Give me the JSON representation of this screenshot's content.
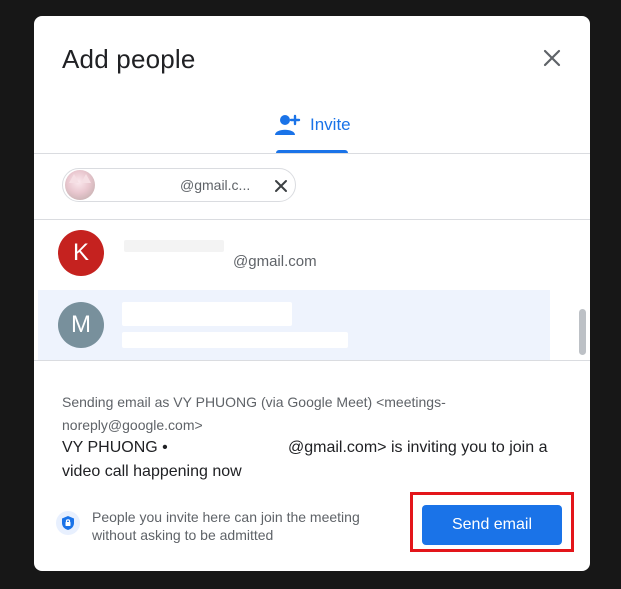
{
  "dialog": {
    "title": "Add people",
    "tab_invite": "Invite",
    "chip": {
      "email": "@gmail.c..."
    },
    "suggestions": [
      {
        "initial": "K",
        "email": "@gmail.com",
        "color": "#c5221f"
      },
      {
        "initial": "M",
        "email": "",
        "color": "#78909c"
      }
    ],
    "sending_note": "Sending email as VY PHUONG (via Google Meet) <meetings-noreply@google.com>",
    "invite_message_part1": "VY PHUONG •",
    "invite_message_part2": "@gmail.com> is inviting you to join a",
    "invite_message_line2": "video call happening now",
    "footer_info": "People you invite here can join the meeting without asking to be admitted",
    "send_button": "Send email"
  },
  "colors": {
    "accent": "#1a73e8",
    "highlight": "#e3151a",
    "avatar_k": "#c5221f",
    "avatar_m": "#78909c"
  },
  "icons": [
    "close-icon",
    "person-add-icon",
    "remove-chip-icon",
    "shield-lock-icon"
  ]
}
